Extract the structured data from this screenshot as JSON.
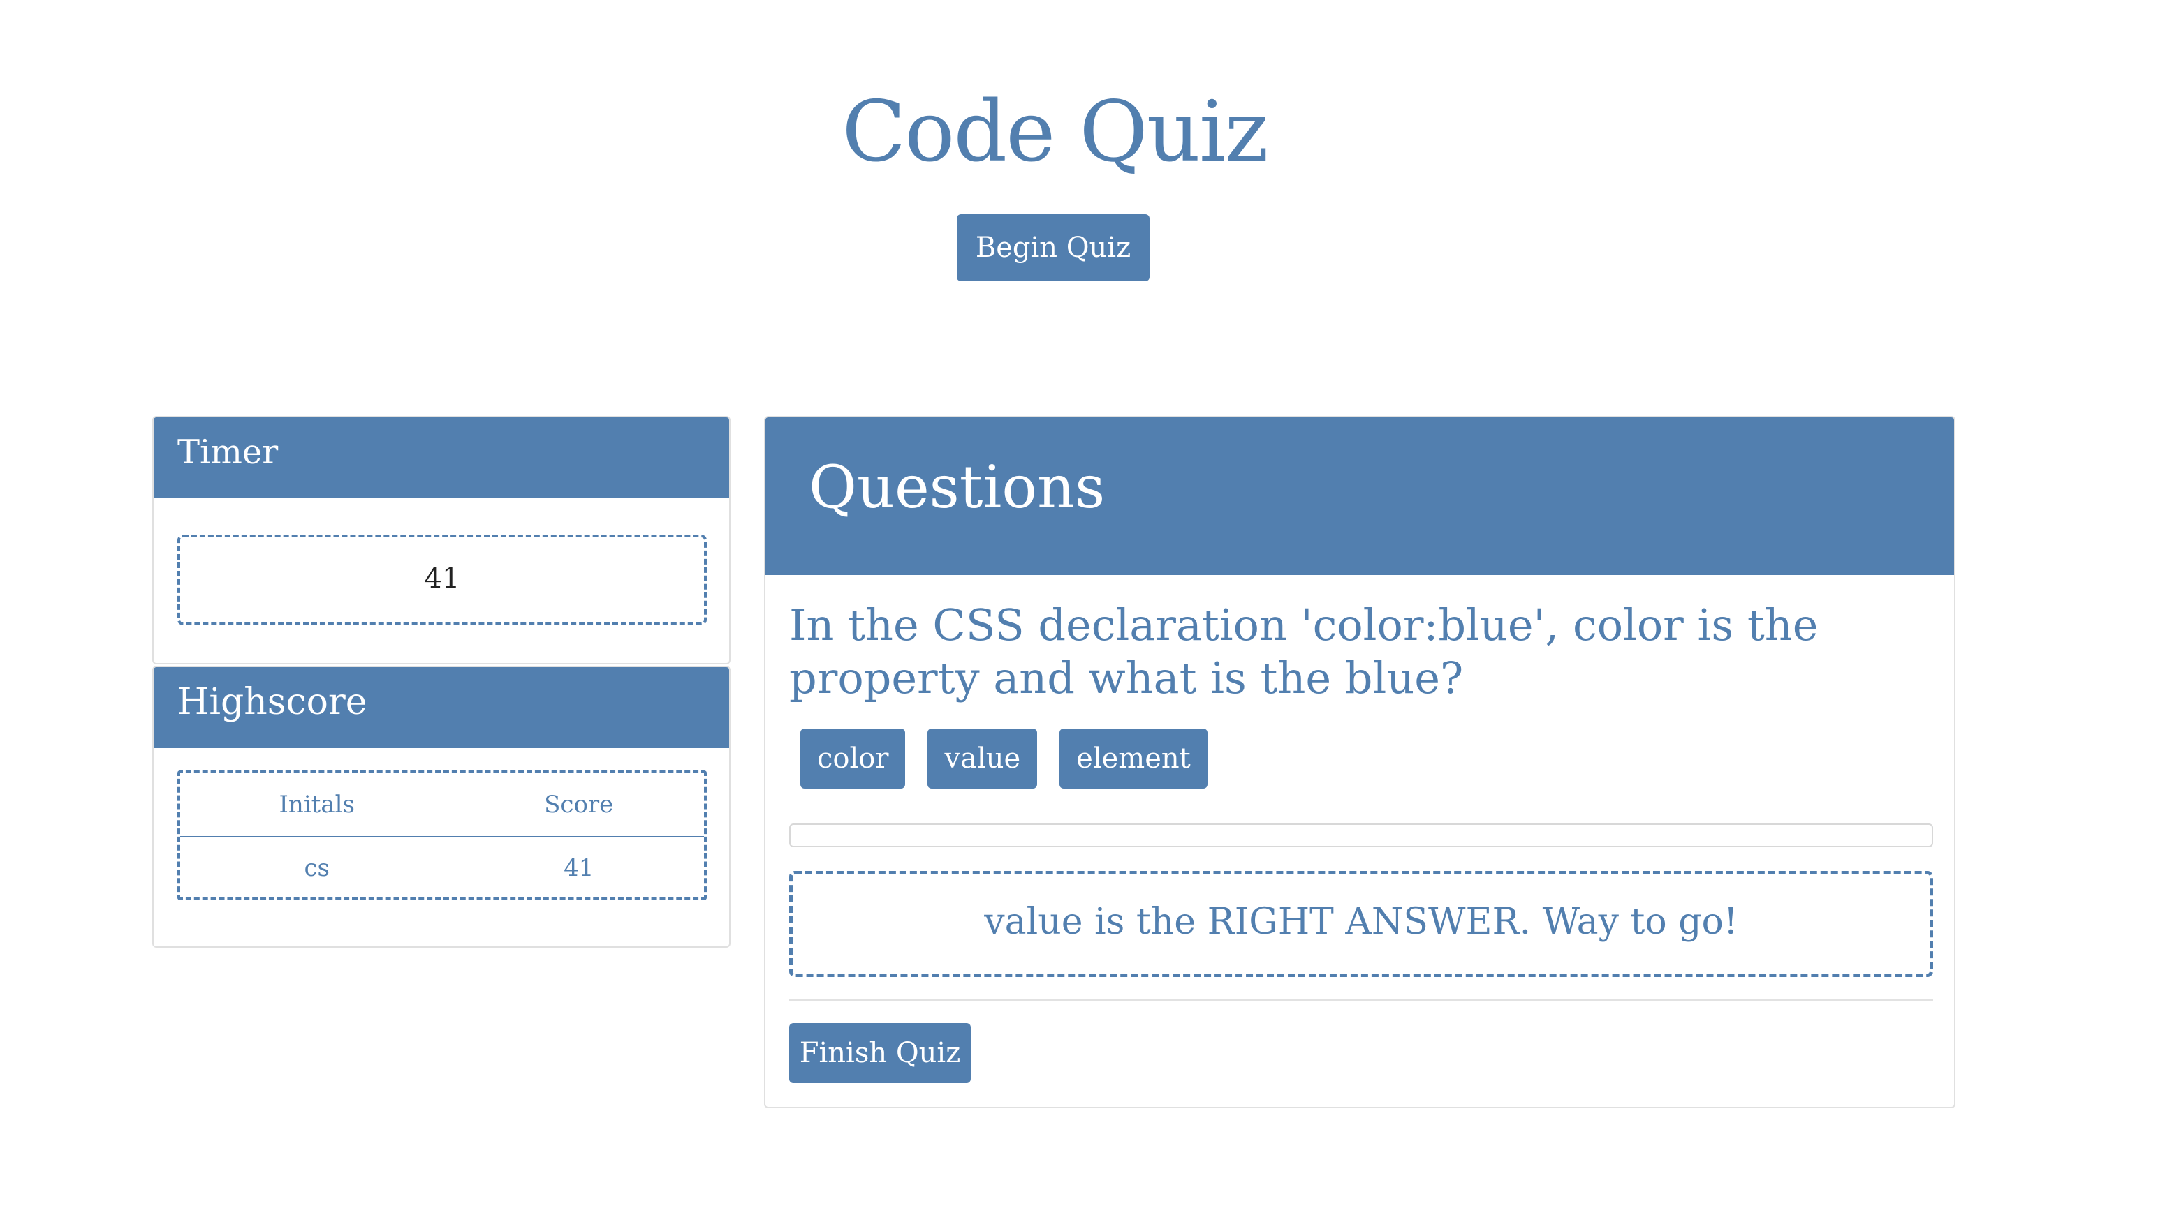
{
  "header": {
    "title": "Code Quiz",
    "begin_label": "Begin Quiz"
  },
  "timer": {
    "title": "Timer",
    "value": "41"
  },
  "highscore": {
    "title": "Highscore",
    "columns": [
      "Initals",
      "Score"
    ],
    "rows": [
      {
        "initials": "cs",
        "score": "41"
      }
    ]
  },
  "questions": {
    "title": "Questions",
    "question_text": "In the CSS declaration 'color:blue', color is the property and what is the blue?",
    "choices": [
      "color",
      "value",
      "element"
    ],
    "progress": 0,
    "feedback": "value is the RIGHT ANSWER. Way to go!",
    "finish_label": "Finish Quiz"
  },
  "colors": {
    "accent": "#527faf",
    "background": "#ffffff",
    "card_border": "#e0e0e0"
  }
}
